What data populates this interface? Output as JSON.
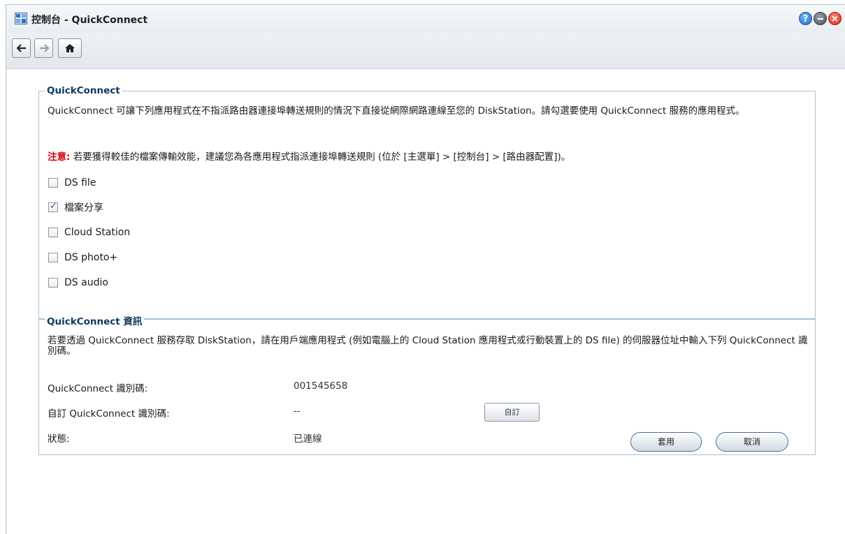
{
  "window": {
    "title": "控制台 - QuickConnect",
    "help_glyph": "?",
    "close_glyph": "×"
  },
  "quickconnect": {
    "legend": "QuickConnect",
    "description": "QuickConnect 可讓下列應用程式在不指派路由器連接埠轉送規則的情況下直接從網際網路連線至您的 DiskStation。請勾選要使用 QuickConnect 服務的應用程式。",
    "notice_label": "注意:",
    "notice_text": "若要獲得較佳的檔案傳輸效能，建議您為各應用程式指派連接埠轉送規則 (位於 [主選單] > [控制台] > [路由器配置])。",
    "apps": [
      {
        "label": "DS file",
        "checked": false
      },
      {
        "label": "檔案分享",
        "checked": true
      },
      {
        "label": "Cloud Station",
        "checked": false
      },
      {
        "label": "DS photo+",
        "checked": false
      },
      {
        "label": "DS audio",
        "checked": false
      }
    ]
  },
  "info": {
    "legend": "QuickConnect 資訊",
    "description": "若要透過 QuickConnect 服務存取 DiskStation，請在用戶端應用程式 (例如電腦上的 Cloud Station 應用程式或行動裝置上的 DS file) 的伺服器位址中輸入下列 QuickConnect 識別碼。",
    "rows": {
      "id_label": "QuickConnect 識別碼:",
      "id_value": "001545658",
      "custom_label": "自訂 QuickConnect 識別碼:",
      "custom_value": "--",
      "custom_button": "自訂",
      "status_label": "狀態:",
      "status_value": "已連線"
    }
  },
  "footer": {
    "apply": "套用",
    "cancel": "取消"
  }
}
